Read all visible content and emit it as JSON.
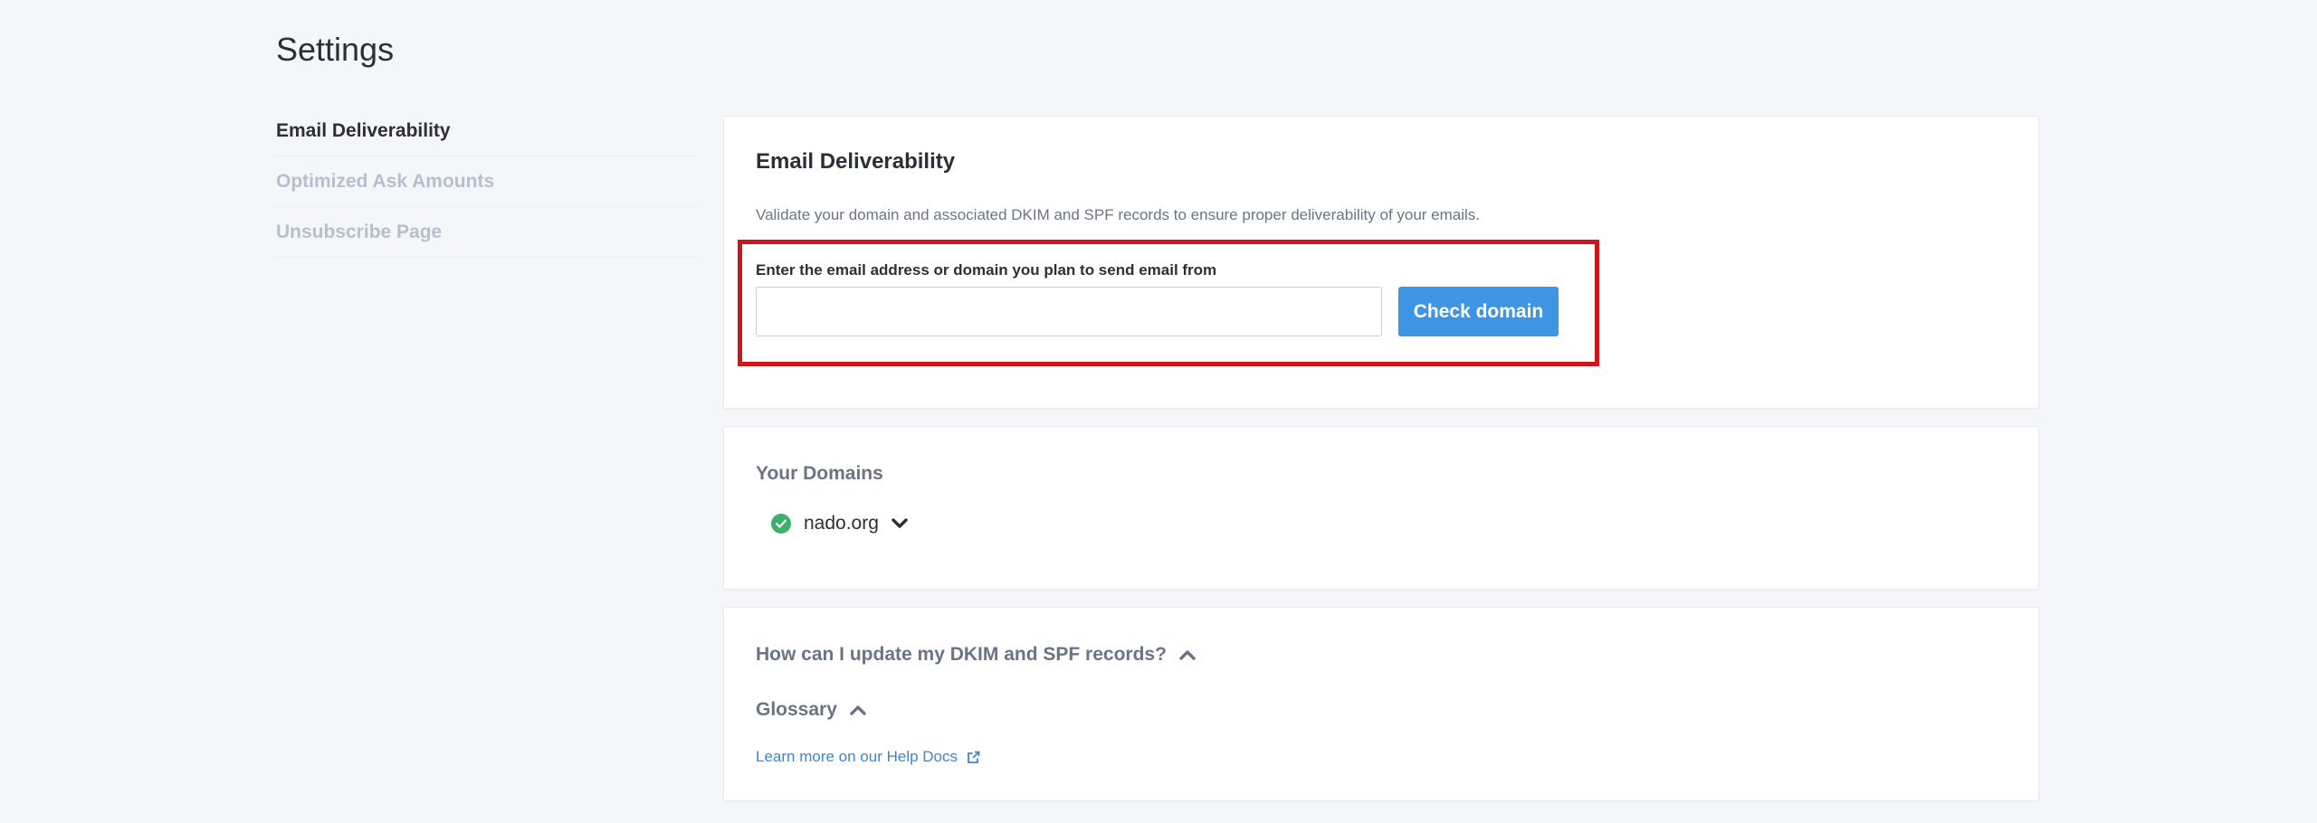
{
  "page": {
    "title": "Settings"
  },
  "sidebar": {
    "items": [
      {
        "label": "Email Deliverability",
        "active": true
      },
      {
        "label": "Optimized Ask Amounts",
        "active": false
      },
      {
        "label": "Unsubscribe Page",
        "active": false
      }
    ]
  },
  "deliverability": {
    "title": "Email Deliverability",
    "description": "Validate your domain and associated DKIM and SPF records to ensure proper deliverability of your emails.",
    "field_label": "Enter the email address or domain you plan to send email from",
    "input_value": "",
    "input_placeholder": "",
    "button_label": "Check domain"
  },
  "domains": {
    "heading": "Your Domains",
    "items": [
      {
        "name": "nado.org",
        "status": "verified",
        "status_icon": "check-circle-icon",
        "expand_icon": "chevron-down-icon"
      }
    ]
  },
  "help": {
    "faq_heading": "How can I update my DKIM and SPF records?",
    "faq_icon": "chevron-up-icon",
    "glossary_heading": "Glossary",
    "glossary_icon": "chevron-up-icon",
    "link_label": "Learn more on our Help Docs",
    "link_icon": "external-link-icon"
  },
  "colors": {
    "primary_button": "#3d95e3",
    "link": "#3d86cf",
    "success": "#3bb26b",
    "highlight_border": "#d0141a",
    "inactive_nav": "#b6bfcf"
  }
}
